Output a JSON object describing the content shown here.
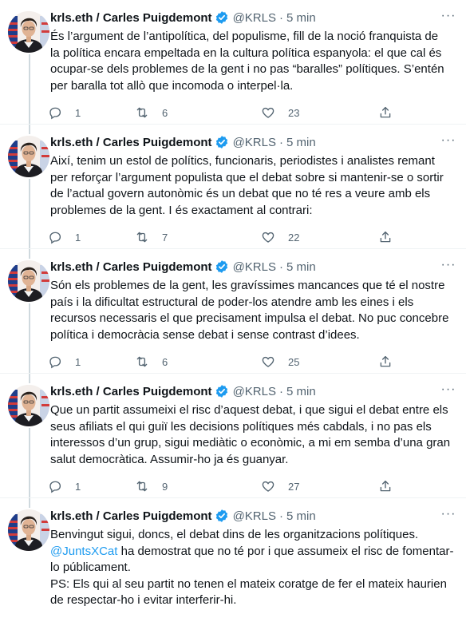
{
  "colors": {
    "text": "#0f1419",
    "secondary": "#536471",
    "accent": "#1d9bf0",
    "divider": "#eff3f4",
    "thread": "#cfd9de"
  },
  "author": {
    "name": "krls.eth / Carles Puigdemont",
    "handle": "@KRLS",
    "verified_icon": "verified-badge-icon"
  },
  "icons": {
    "reply": "reply-icon",
    "retweet": "retweet-icon",
    "like": "heart-icon",
    "share": "share-icon",
    "more": "more-icon"
  },
  "tweets": [
    {
      "time": "5 min",
      "lines": [
        "És l’argument de l’antipolítica, del populisme, fill de la noció franquista de",
        "la política encara empeltada en la cultura política espanyola: el que cal és",
        "ocupar-se dels problemes de la gent i no pas “baralles” polítiques. S’entén",
        "per baralla tot allò que incomoda o interpel·la."
      ],
      "replies": "1",
      "retweets": "6",
      "likes": "23"
    },
    {
      "time": "5 min",
      "lines": [
        "Així, tenim un estol de polítics, funcionaris, periodistes i analistes remant",
        "per reforçar l’argument populista que el debat sobre si mantenir-se o sortir",
        "de l’actual govern autonòmic és un debat que no té res a veure amb els",
        "problemes de la gent. I és exactament al contrari:"
      ],
      "replies": "1",
      "retweets": "7",
      "likes": "22"
    },
    {
      "time": "5 min",
      "lines": [
        "Són els problemes de la gent, les gravíssimes mancances que té el nostre",
        "país i la dificultat estructural de poder-los atendre amb les eines i els",
        "recursos necessaris el que precisament impulsa el debat. No puc concebre",
        "política i democràcia sense debat i sense contrast d’idees."
      ],
      "replies": "1",
      "retweets": "6",
      "likes": "25"
    },
    {
      "time": "5 min",
      "lines": [
        "Que un partit assumeixi el risc d’aquest debat, i que sigui el debat entre els",
        "seus afiliats el qui guiï les decisions polítiques més cabdals, i no pas els",
        "interessos d’un grup, sigui mediàtic o econòmic, a mi em semba d’una gran",
        "salut democràtica. Assumir-ho ja és guanyar."
      ],
      "replies": "1",
      "retweets": "9",
      "likes": "27"
    },
    {
      "time": "5 min",
      "lines": [
        "Benvingut sigui, doncs, el debat dins de les organitzacions polítiques.",
        "",
        "lo públicament.",
        "PS: Els qui al seu partit no tenen el mateix coratge de fer el mateix haurien",
        "de respectar-ho i evitar interferir-hi."
      ],
      "mention": "@JuntsXCat",
      "mention_rest": " ha demostrat que no té por i que assumeix el risc de fomentar-"
    }
  ]
}
